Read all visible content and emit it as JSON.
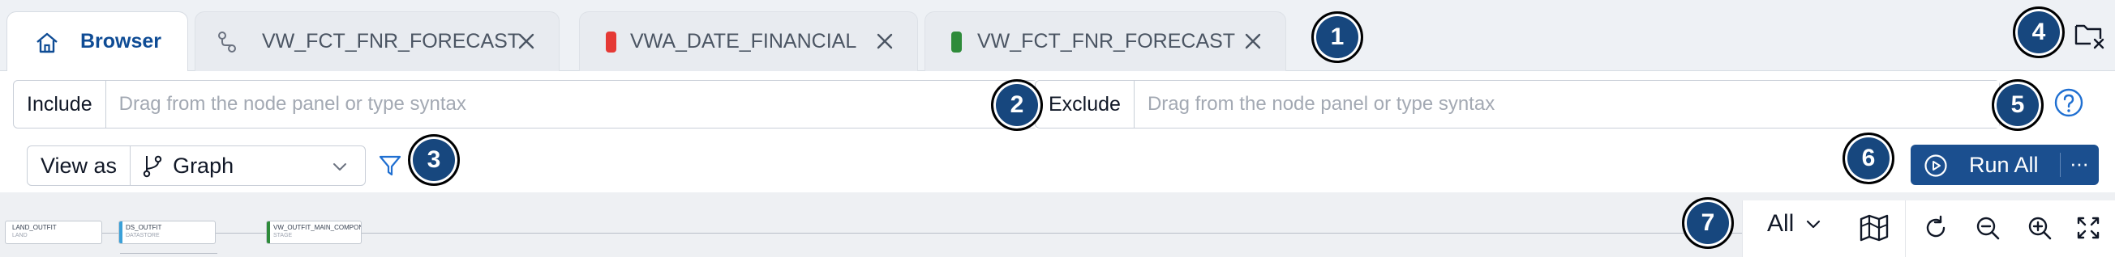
{
  "tabs": [
    {
      "label": "Browser",
      "icon": "home-icon",
      "active": true
    },
    {
      "label": "VW_FCT_FNR_FORECAST",
      "icon": "model-link-icon",
      "closable": true
    },
    {
      "label": "VWA_DATE_FINANCIAL",
      "icon": "status-dot-red",
      "dot_color": "#e53935",
      "closable": true
    },
    {
      "label": "VW_FCT_FNR_FORECAST",
      "icon": "status-dot-green",
      "dot_color": "#2e8b3a",
      "closable": true
    }
  ],
  "markers": [
    "1",
    "2",
    "3",
    "4",
    "5",
    "6",
    "7"
  ],
  "filters": {
    "include_label": "Include",
    "include_placeholder": "Drag from the node panel or type syntax",
    "exclude_label": "Exclude",
    "exclude_placeholder": "Drag from the node panel or type syntax"
  },
  "view": {
    "view_as_label": "View as",
    "selected": "Graph"
  },
  "run": {
    "label": "Run All",
    "more": "···"
  },
  "graph": {
    "nodes": [
      {
        "title": "LAND_OUTFIT",
        "subtitle": "LAND",
        "accent": ""
      },
      {
        "title": "DS_OUTFIT",
        "subtitle": "DATASTORE",
        "accent": "#3aa0d8"
      },
      {
        "title": "VW_OUTFIT_MAIN_COMPON...",
        "subtitle": "STAGE",
        "accent": "#2e8b3a"
      }
    ]
  },
  "controls": {
    "filter_selected": "All"
  },
  "colors": {
    "accent": "#1b4f8f",
    "marker_bg": "#17477e",
    "tab_active_text": "#0f4c95"
  }
}
